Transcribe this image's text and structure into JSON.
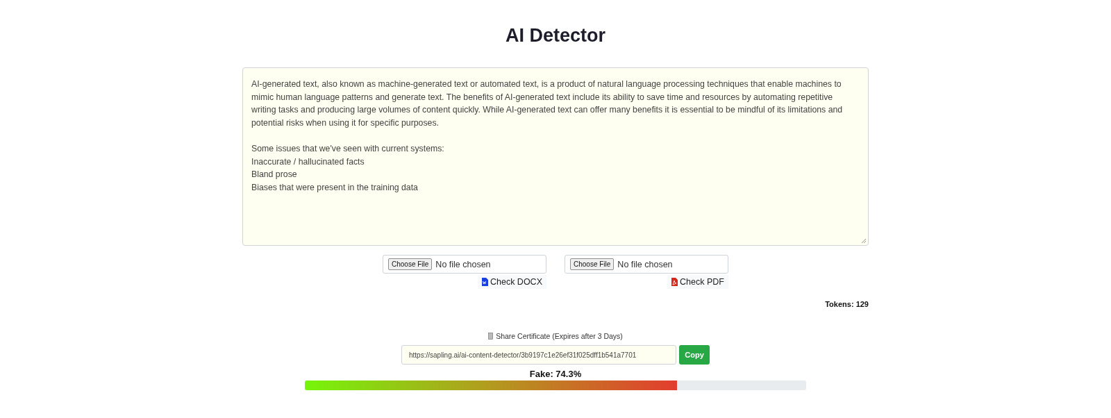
{
  "title": "AI Detector",
  "text_input": {
    "value": "AI-generated text, also known as machine-generated text or automated text, is a product of natural language processing techniques that enable machines to mimic human language patterns and generate text. The benefits of AI-generated text include its ability to save time and resources by automating repetitive writing tasks and producing large volumes of content quickly. While AI-generated text can offer many benefits it is essential to be mindful of its limitations and potential risks when using it for specific purposes.\n\nSome issues that we've seen with current systems:\nInaccurate / hallucinated facts\nBland prose\nBiases that were present in the training data"
  },
  "uploads": [
    {
      "kind": "docx",
      "button": "Choose File",
      "status": "No file chosen",
      "check": "Check DOCX"
    },
    {
      "kind": "pdf",
      "button": "Choose File",
      "status": "No file chosen",
      "check": "Check PDF"
    }
  ],
  "tokens": "Tokens: 129",
  "share": {
    "label": "Share Certificate (Expires after 3 Days)",
    "url": "https://sapling.ai/ai-content-detector/3b9197c1e26ef31f025dff1b541a7701",
    "copy": "Copy"
  },
  "result": {
    "label": "Fake: 74.3%",
    "level": 0.743
  }
}
